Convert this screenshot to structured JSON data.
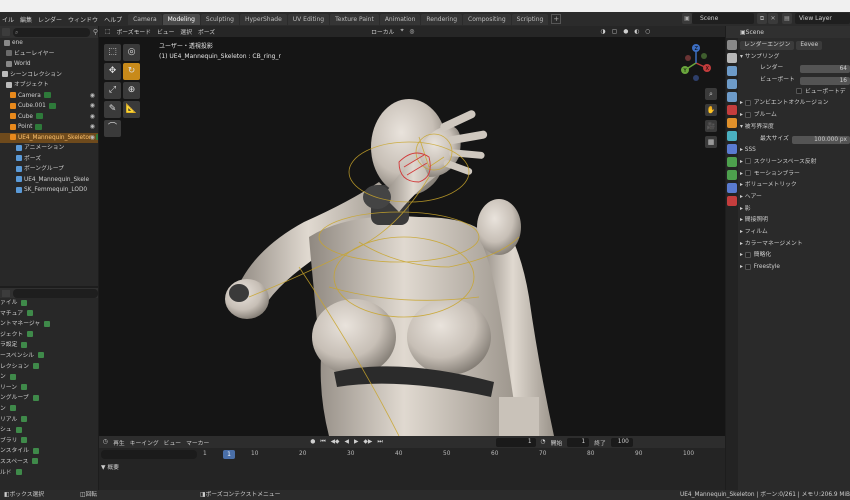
{
  "menu": [
    "イル",
    "編集",
    "レンダー",
    "ウィンドウ",
    "ヘルプ"
  ],
  "workspace_tabs": [
    {
      "label": "Camera",
      "active": false
    },
    {
      "label": "Modeling",
      "active": true
    },
    {
      "label": "Sculpting",
      "active": false
    },
    {
      "label": "HyperShade",
      "active": false
    },
    {
      "label": "UV Editing",
      "active": false
    },
    {
      "label": "Texture Paint",
      "active": false
    },
    {
      "label": "Animation",
      "active": false
    },
    {
      "label": "Rendering",
      "active": false
    },
    {
      "label": "Compositing",
      "active": false
    },
    {
      "label": "Scripting",
      "active": false
    }
  ],
  "workspace_add": "+",
  "scene_name": "Scene",
  "view_layer": "View Layer",
  "outliner": {
    "search_icon": "⌕",
    "rows": [
      {
        "label": "ene",
        "color": "#888888",
        "selected": false,
        "eye": false
      },
      {
        "label": "ビューレイヤー",
        "color": "#6b6b6b",
        "selected": false,
        "eye": false
      },
      {
        "label": "World",
        "color": "#888888",
        "selected": false,
        "eye": false
      },
      {
        "label": "シーンコレクション",
        "color": "#bbbbbb",
        "selected": false,
        "eye": false
      },
      {
        "label": "オブジェクト",
        "color": "#bbbbbb",
        "selected": false,
        "eye": false
      },
      {
        "label": "Camera",
        "color": "#e8891c",
        "selected": false,
        "eye": true
      },
      {
        "label": "Cube.001",
        "color": "#e8891c",
        "selected": false,
        "eye": true
      },
      {
        "label": "Cube",
        "color": "#e8891c",
        "selected": false,
        "eye": true
      },
      {
        "label": "Point",
        "color": "#e8891c",
        "selected": false,
        "eye": true
      },
      {
        "label": "UE4_Mannequin_Skeleton",
        "color": "#e8891c",
        "selected": true,
        "eye": true
      },
      {
        "label": "アニメーション",
        "color": "#5a9ad8",
        "selected": false,
        "eye": false
      },
      {
        "label": "ポーズ",
        "color": "#5a9ad8",
        "selected": false,
        "eye": false
      },
      {
        "label": "ボーングループ",
        "color": "#5a9ad8",
        "selected": false,
        "eye": false
      },
      {
        "label": "UE4_Mannequin_Skele",
        "color": "#5a9ad8",
        "selected": false,
        "eye": false
      },
      {
        "label": "SK_Femmequin_LOD0",
        "color": "#5a9ad8",
        "selected": false,
        "eye": false
      }
    ]
  },
  "props_left": {
    "rows": [
      "ァイル",
      "マチュア",
      "ントマネージャ",
      "ジェクト",
      "ラ設定",
      "ースペンシル",
      "レクション",
      "ン",
      "リーン",
      "ングループ",
      "ン",
      "リアル",
      "シュ",
      "ブラリ",
      "ンスタイル",
      "ススペース",
      "ルド"
    ]
  },
  "viewport": {
    "header": [
      "ポーズモード",
      "ビュー",
      "選択",
      "ポーズ"
    ],
    "header_right": [
      "ローカル"
    ],
    "info_line1": "ユーザー・透視投影",
    "info_line2": "(1) UE4_Mannequin_Skeleton : CB_ring_r",
    "gizmo": {
      "x": "X",
      "y": "Y",
      "z": "Z"
    }
  },
  "timeline": {
    "header": [
      "再生",
      "キーイング",
      "ビュー",
      "マーカー"
    ],
    "current_frame": "1",
    "start_label": "開始",
    "start_value": "1",
    "end_label": "終了",
    "end_value": "100",
    "ruler": [
      "1",
      "10",
      "20",
      "30",
      "40",
      "50",
      "60",
      "70",
      "80",
      "90",
      "100"
    ],
    "cursor": "1",
    "summary": "概要"
  },
  "props_right": {
    "header": "Scene",
    "tab_colors": [
      "#888888",
      "#b8b8b8",
      "#6d9bc9",
      "#6d9bc9",
      "#6d9bc9",
      "#c43d3d",
      "#e0902b",
      "#4ab0c0",
      "#5a7bd0",
      "#4da04d",
      "#4da04d",
      "#5a7bd0",
      "#c43d3d"
    ],
    "render_engine_label": "レンダーエンジン",
    "render_engine_value": "Eevee",
    "sampling": "サンプリング",
    "render_label": "レンダー",
    "render_value": "64",
    "viewport_label": "ビューポート",
    "viewport_value": "16",
    "viewport_denoise": "ビューポートデ",
    "ao": "アンビエントオクルージョン",
    "bloom": "ブルーム",
    "dof": "被写界深度",
    "max_size_label": "最大サイズ",
    "max_size_value": "100.000 px",
    "sss": "SSS",
    "ssr": "スクリーンスペース反射",
    "motion_blur": "モーションブラー",
    "volumetric": "ボリューメトリック",
    "hair": "ヘアー",
    "shadow": "影",
    "indirect": "間接照明",
    "film": "フィルム",
    "color_mgmt": "カラーマネージメント",
    "simplify": "簡略化",
    "freestyle": "Freestyle"
  },
  "status": {
    "left": "ボックス選択",
    "mid1": "回転",
    "mid2": "ポーズコンテクストメニュー",
    "right": "UE4_Mannequin_Skeleton | ボーン:0/261 | メモリ:206.9 MiB | v2"
  }
}
